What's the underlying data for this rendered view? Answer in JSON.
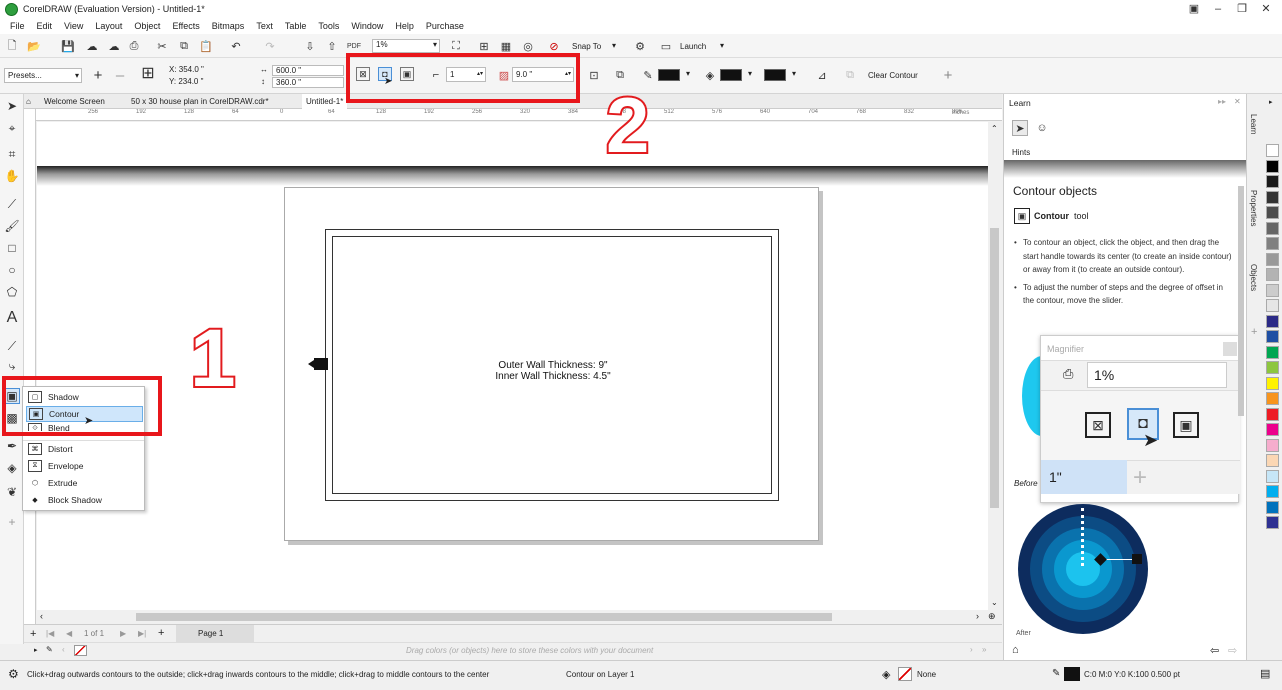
{
  "app": {
    "title": "CorelDRAW (Evaluation Version) - Untitled-1*",
    "brand_color": "#2e9e3e"
  },
  "menu": [
    "File",
    "Edit",
    "View",
    "Layout",
    "Object",
    "Effects",
    "Bitmaps",
    "Text",
    "Table",
    "Tools",
    "Window",
    "Help",
    "Purchase"
  ],
  "standard_toolbar": {
    "zoom": "1%",
    "snap_to": "Snap To",
    "launch": "Launch"
  },
  "property_bar": {
    "presets": "Presets...",
    "x": "X: 354.0 \"",
    "y": "Y: 234.0 \"",
    "width": "600.0 \"",
    "height": "360.0 \"",
    "steps": "1",
    "offset": "9.0 \"",
    "clear_contour": "Clear Contour"
  },
  "annotations": {
    "num1": "1",
    "num2": "2",
    "highlight_color": "#e8161b"
  },
  "doc_tabs": [
    "Welcome Screen",
    "50 x 30 house plan in CorelDRAW.cdr*",
    "Untitled-1*"
  ],
  "ruler": {
    "h_ticks": [
      "256",
      "192",
      "128",
      "64",
      "0",
      "64",
      "128",
      "192",
      "256",
      "320",
      "384",
      "448",
      "512",
      "576",
      "640",
      "704",
      "768",
      "832",
      "896"
    ],
    "h_unit": "inches"
  },
  "canvas": {
    "line1": "Outer Wall Thickness: 9\"",
    "line2": "Inner Wall Thickness: 4.5\""
  },
  "flyout": [
    "Shadow",
    "Contour",
    "Blend",
    "Distort",
    "Envelope",
    "Extrude",
    "Block Shadow"
  ],
  "page_nav": {
    "counter": "1 of 1",
    "page_tab": "Page 1"
  },
  "palette_hint": "Drag colors (or objects) here to store these colors with your document",
  "status": {
    "hint": "Click+drag outwards contours to the outside; click+drag inwards contours to the middle; click+drag to middle contours to the center",
    "layer": "Contour on Layer 1",
    "fill": "None",
    "outline": "C:0 M:0 Y:0 K:100  0.500 pt"
  },
  "learn": {
    "title": "Learn",
    "hints": "Hints",
    "heading": "Contour objects",
    "tool_bold": "Contour",
    "tool_rest": " tool",
    "bullets": [
      "To contour an object, click the object, and then drag the start handle towards its center (to create an inside contour) or away from it (to create an outside contour).",
      "To adjust the number of steps and the degree of offset in the contour, move the slider."
    ],
    "magnifier_title": "Magnifier",
    "magnifier_zoom": "1%",
    "magnifier_field": "1\"",
    "before": "Before",
    "after": "After"
  },
  "docker_tabs": [
    "Learn",
    "Properties",
    "Objects"
  ],
  "palette_colors": [
    "#ffffff",
    "#000000",
    "#1a1a1a",
    "#333333",
    "#4d4d4d",
    "#666666",
    "#808080",
    "#999999",
    "#b3b3b3",
    "#cccccc",
    "#e6e6e6",
    "#2b2a86",
    "#1f4fa3",
    "#00a651",
    "#8dc63f",
    "#fff200",
    "#f7941d",
    "#ed1c24",
    "#ec008c",
    "#f6adcd",
    "#fbd7b4",
    "#c6e6f7",
    "#00aeef",
    "#0072bc",
    "#2e3192"
  ]
}
